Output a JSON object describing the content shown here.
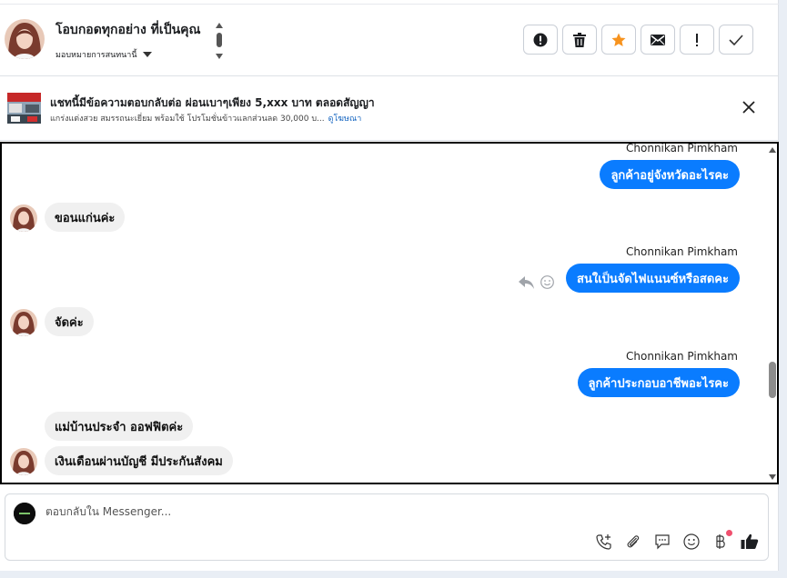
{
  "header": {
    "contact_name": "โอบกอดทุกอย่าง ที่เป็นคุณ",
    "assign_label": "มอบหมายการสนทนานี้",
    "toolbar": [
      {
        "name": "spam-button",
        "icon": "alert-circle-icon"
      },
      {
        "name": "delete-button",
        "icon": "trash-icon"
      },
      {
        "name": "star-button",
        "icon": "star-icon"
      },
      {
        "name": "mark-unread-button",
        "icon": "envelope-icon"
      },
      {
        "name": "follow-up-button",
        "icon": "exclamation-icon"
      },
      {
        "name": "mark-done-button",
        "icon": "check-icon"
      }
    ]
  },
  "ad_banner": {
    "title": "แชทนี้มีข้อความตอบกลับต่อ ผ่อนเบาๆเพียง 5,xxx บาท ตลอดสัญญา",
    "subtitle": "แกร่งแต่งสวย สมรรถนะเยี่ยม พร้อมใช้ โปรโมชั่นข้าวแลกส่วนลด 30,000 บ...",
    "link": "ดูโฆษณา"
  },
  "messages": {
    "m1": {
      "sender": "Chonnikan Pimkham",
      "text": "ลูกค้าอยู่จังหวัดอะไรคะ"
    },
    "m2": {
      "text": "ขอนแก่นค่ะ"
    },
    "m3": {
      "sender": "Chonnikan Pimkham",
      "text": "สนใเป็นจัดไฟแนนซ์หรือสดคะ"
    },
    "m4": {
      "text": "จัดค่ะ"
    },
    "m5": {
      "sender": "Chonnikan Pimkham",
      "text": "ลูกค้าประกอบอาชีพอะไรคะ"
    },
    "m6": {
      "text": "แม่บ้านประจำ ออฟฟิตค่ะ"
    },
    "m7": {
      "text": "เงินเดือนผ่านบัญชี มีประกันสังคม"
    }
  },
  "composer": {
    "placeholder": "ตอบกลับใน Messenger...",
    "tools": [
      "call-add-icon",
      "paperclip-icon",
      "saved-reply-icon",
      "emoji-icon",
      "baht-icon",
      "thumbs-up-icon"
    ]
  },
  "colors": {
    "bubble_out": "#0a7cff",
    "bubble_in": "#f0f0f0",
    "star": "#f7931e",
    "notify_dot": "#f0506e"
  }
}
